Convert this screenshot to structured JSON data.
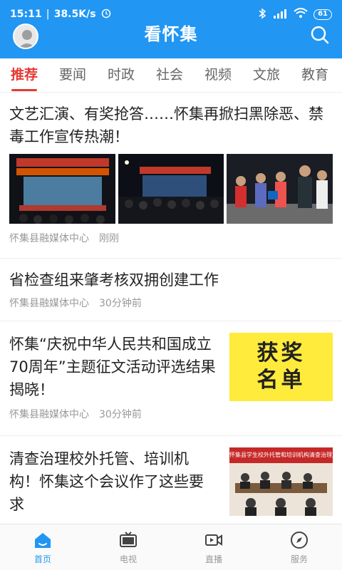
{
  "status": {
    "time": "15:11",
    "speed": "38.5K/s",
    "battery": "61"
  },
  "header": {
    "title": "看怀集"
  },
  "tabs": [
    "推荐",
    "要闻",
    "时政",
    "社会",
    "视频",
    "文旅",
    "教育"
  ],
  "articles": [
    {
      "title": "文艺汇演、有奖抢答……怀集再掀扫黑除恶、禁毒工作宣传热潮！",
      "source": "怀集县融媒体中心",
      "time": "刚刚"
    },
    {
      "title": "省检查组来肇考核双拥创建工作",
      "source": "怀集县融媒体中心",
      "time": "30分钟前"
    },
    {
      "title": "怀集“庆祝中华人民共和国成立70周年”主题征文活动评选结果揭晓！",
      "source": "怀集县融媒体中心",
      "time": "30分钟前",
      "thumb_text": "获奖名单"
    },
    {
      "title": "清查治理校外托管、培训机构！怀集这个会议作了这些要求",
      "thumb_text": "怀集县学生校外托管和培训机构清查治理工作部署"
    }
  ],
  "nav": [
    "首页",
    "电视",
    "直播",
    "服务"
  ],
  "colors": {
    "primary": "#2196f3",
    "active_tab": "#e53935"
  }
}
